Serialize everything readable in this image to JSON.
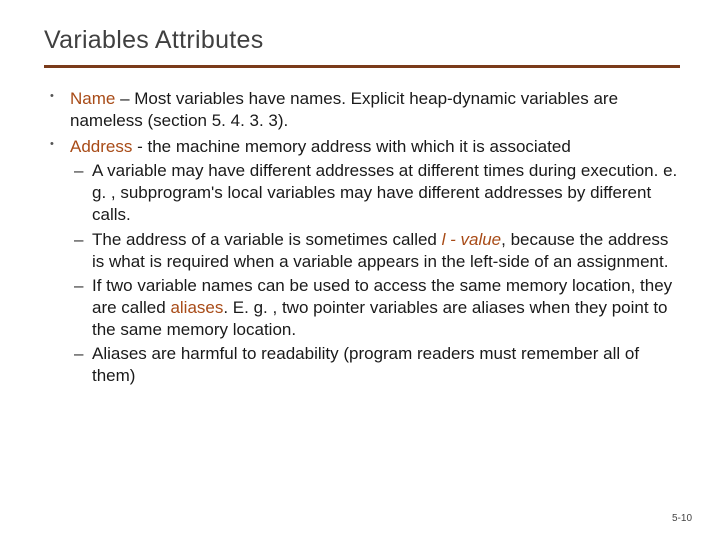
{
  "title": "Variables Attributes",
  "b1": {
    "key": "Name",
    "text": " – Most variables have names. Explicit heap-dynamic variables are nameless (section 5. 4. 3. 3)."
  },
  "b2": {
    "key": "Address",
    "text": " - the machine memory address with which it is associated"
  },
  "b2s1": "A variable may have different addresses at different times during execution. e. g. , subprogram's local variables may have different addresses by different calls.",
  "b2s2": {
    "pre": "The address of a variable is sometimes called ",
    "term": "l - value",
    "post": ", because the address is what is required when a variable appears in the left-side of an assignment."
  },
  "b2s3": {
    "pre": "If two variable names can be used to access the same memory location, they are called ",
    "term": "aliases",
    "post": ". E. g. , two pointer variables are aliases when they point to the same memory location."
  },
  "b2s4": "Aliases are harmful to readability (program readers must remember all of them)",
  "pagenum": "5-10"
}
